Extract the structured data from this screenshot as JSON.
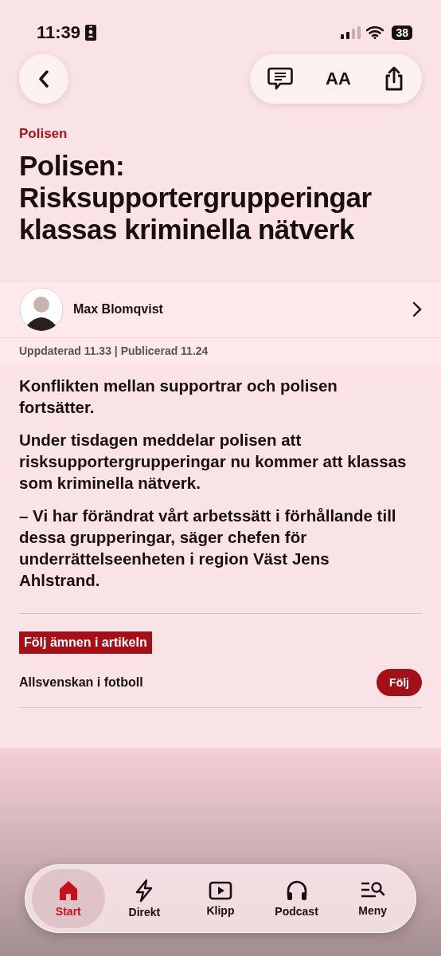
{
  "status_bar": {
    "time": "11:39",
    "battery": "38"
  },
  "toolbar": {
    "text_size_label": "AA"
  },
  "article": {
    "category": "Polisen",
    "headline": "Polisen: Risksupportergrupperingar klassas kriminella nätverk",
    "author": {
      "name": "Max Blomqvist"
    },
    "meta": "Uppdaterad 11.33 | Publicerad 11.24",
    "paragraphs": [
      "Konflikten mellan supportrar och polisen fortsätter.",
      "Under tisdagen meddelar polisen att risksupportergrupperingar nu kommer att klassas som kriminella nätverk.",
      "– Vi har förändrat vårt arbetssätt i förhållande till dessa grupperingar, säger chefen för underrättelseenheten i region Väst Jens Ahlstrand."
    ]
  },
  "topics": {
    "heading": "Följ ämnen i artikeln",
    "items": [
      {
        "name": "Allsvenskan i fotboll",
        "button": "Följ"
      }
    ]
  },
  "tab_bar": [
    {
      "label": "Start",
      "kind": "home",
      "selected": true
    },
    {
      "label": "Direkt",
      "kind": "live",
      "selected": false
    },
    {
      "label": "Klipp",
      "kind": "video",
      "selected": false
    },
    {
      "label": "Podcast",
      "kind": "podcast",
      "selected": false
    },
    {
      "label": "Meny",
      "kind": "menu",
      "selected": false
    }
  ]
}
